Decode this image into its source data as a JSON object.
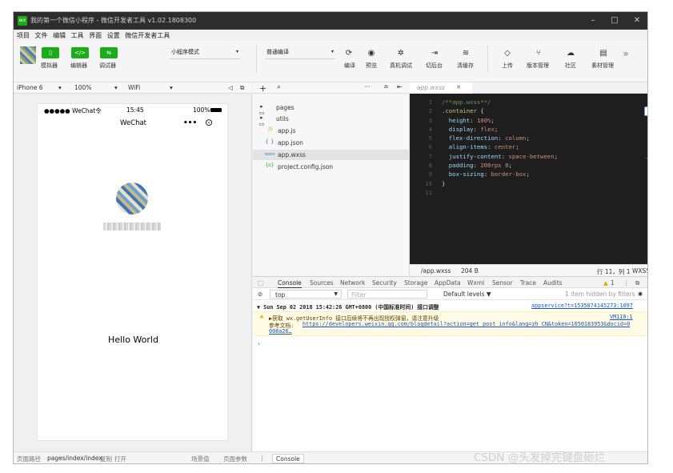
{
  "window": {
    "title": "我的第一个微信小程序 - 微信开发者工具 v1.02.1808300",
    "app_icon": "wx",
    "controls": {
      "minimize": "–",
      "maximize": "□",
      "close": "✕"
    }
  },
  "menu": [
    "项目",
    "文件",
    "编辑",
    "工具",
    "界面",
    "设置",
    "微信开发者工具"
  ],
  "toolbar": {
    "buttons": [
      {
        "icon": "phone-icon",
        "glyph": "▯",
        "label": "模拟器"
      },
      {
        "icon": "code-icon",
        "glyph": "</>",
        "label": "编辑器"
      },
      {
        "icon": "debug-icon",
        "glyph": "⇆",
        "label": "调试器"
      }
    ],
    "mode_select": "小程序模式",
    "compile_select": "普通编译",
    "actions": [
      {
        "icon": "refresh-icon",
        "glyph": "⟳",
        "label": "编译"
      },
      {
        "icon": "eye-icon",
        "glyph": "◉",
        "label": "预览"
      },
      {
        "icon": "bug-icon",
        "glyph": "✲",
        "label": "真机调试"
      },
      {
        "icon": "switch-icon",
        "glyph": "⇥",
        "label": "切后台"
      },
      {
        "icon": "stack-icon",
        "glyph": "≋",
        "label": "清缓存"
      },
      {
        "icon": "upload-icon",
        "glyph": "◇",
        "label": "上传"
      },
      {
        "icon": "branch-icon",
        "glyph": "⑂",
        "label": "版本管理"
      },
      {
        "icon": "cloud-icon",
        "glyph": "☁",
        "label": "社区"
      },
      {
        "icon": "doc-icon",
        "glyph": "▤",
        "label": "素材管理"
      }
    ],
    "more": "»"
  },
  "simulator": {
    "device": "iPhone 6",
    "zoom": "100%",
    "network": "WiFi",
    "status_left": "●●●●● WeChat令",
    "status_time": "15:45",
    "status_battery": "100%",
    "nav_title": "WeChat",
    "nav_more": "•••",
    "nav_target": "⊙",
    "content_text": "Hello World"
  },
  "file_tree": {
    "header_add": "+",
    "header_search": "⌕",
    "header_more": "···",
    "header_sort": "≐",
    "header_collapse": "⇤",
    "items": [
      {
        "name": "pages",
        "icon": "▸ ▭",
        "type": "folder"
      },
      {
        "name": "utils",
        "icon": "▸ ▭",
        "type": "folder"
      },
      {
        "name": "app.js",
        "icon": "JS",
        "type": "js"
      },
      {
        "name": "app.json",
        "icon": "{ }",
        "type": "json"
      },
      {
        "name": "app.wxss",
        "icon": "wxss",
        "type": "wxss",
        "selected": true
      },
      {
        "name": "project.config.json",
        "icon": "{o}",
        "type": "config"
      }
    ]
  },
  "editor": {
    "tab": "app.wxss",
    "tab_close": "×",
    "line_numbers": [
      "1",
      "2",
      "3",
      "4",
      "5",
      "6",
      "7",
      "8",
      "9",
      "10",
      "11"
    ],
    "lines": [
      [
        {
          "t": "/**app.wxss**/",
          "c": "#6a9955"
        }
      ],
      [
        {
          "t": ".container",
          "c": "#d7ba7d"
        },
        {
          "t": " {",
          "c": "#d4d4d4"
        }
      ],
      [
        {
          "t": "  height",
          "c": "#9cdcfe"
        },
        {
          "t": ": ",
          "c": "#d4d4d4"
        },
        {
          "t": "100%",
          "c": "#ce9178"
        },
        {
          "t": ";",
          "c": "#d4d4d4"
        }
      ],
      [
        {
          "t": "  display",
          "c": "#9cdcfe"
        },
        {
          "t": ": ",
          "c": "#d4d4d4"
        },
        {
          "t": "flex",
          "c": "#ce9178"
        },
        {
          "t": ";",
          "c": "#d4d4d4"
        }
      ],
      [
        {
          "t": "  flex-direction",
          "c": "#9cdcfe"
        },
        {
          "t": ": ",
          "c": "#d4d4d4"
        },
        {
          "t": "column",
          "c": "#ce9178"
        },
        {
          "t": ";",
          "c": "#d4d4d4"
        }
      ],
      [
        {
          "t": "  align-items",
          "c": "#9cdcfe"
        },
        {
          "t": ": ",
          "c": "#d4d4d4"
        },
        {
          "t": "center",
          "c": "#ce9178"
        },
        {
          "t": ";",
          "c": "#d4d4d4"
        }
      ],
      [
        {
          "t": "  justify-content",
          "c": "#9cdcfe"
        },
        {
          "t": ": ",
          "c": "#d4d4d4"
        },
        {
          "t": "space-between",
          "c": "#ce9178"
        },
        {
          "t": ";",
          "c": "#d4d4d4"
        }
      ],
      [
        {
          "t": "  padding",
          "c": "#9cdcfe"
        },
        {
          "t": ": ",
          "c": "#d4d4d4"
        },
        {
          "t": "200rpx 0",
          "c": "#ce9178"
        },
        {
          "t": ";",
          "c": "#d4d4d4"
        }
      ],
      [
        {
          "t": "  box-sizing",
          "c": "#9cdcfe"
        },
        {
          "t": ": ",
          "c": "#d4d4d4"
        },
        {
          "t": "border-box",
          "c": "#ce9178"
        },
        {
          "t": ";",
          "c": "#d4d4d4"
        }
      ],
      [
        {
          "t": "}",
          "c": "#d4d4d4"
        }
      ],
      [
        {
          "t": "",
          "c": "#d4d4d4"
        }
      ]
    ],
    "status_path": "/app.wxss",
    "status_size": "204 B",
    "status_pos": "行 11，列 1",
    "status_lang": "WXSS"
  },
  "devtools": {
    "tabs": [
      "Console",
      "Sources",
      "Network",
      "Security",
      "Storage",
      "AppData",
      "Wxml",
      "Sensor",
      "Trace",
      "Audits"
    ],
    "active_tab": "Console",
    "warn_count": "1",
    "context": "top",
    "filter_placeholder": "Filter",
    "levels": "Default levels ▼",
    "hidden": "1 item hidden by filters",
    "group_line": "▼ Sun Sep 02 2018 15:42:26 GMT+0800 (中国标准时间) 接口调整",
    "group_source": "appservice?t=1535874145273:1097",
    "warn_line1": "▶获取 wx.getUserInfo 接口后续将不再出现授权弹窗，请注意升级",
    "warn_source": "VM110:1",
    "warn_line2_prefix": "参考文档: ",
    "warn_link": "https://developers.weixin.qq.com/blogdetail?action=get_post_info&lang=zh_CN&token=1650183953&docid=0",
    "warn_line3": "008a26…",
    "prompt": "›",
    "drawer_label": "Console"
  },
  "bottombar": {
    "path_label": "页面路径",
    "path": "pages/index/index",
    "copy": "复制",
    "open": "打开",
    "scene": "场景值",
    "params": "页面参数"
  },
  "watermark": "CSDN @头发掉完键盘砸烂"
}
